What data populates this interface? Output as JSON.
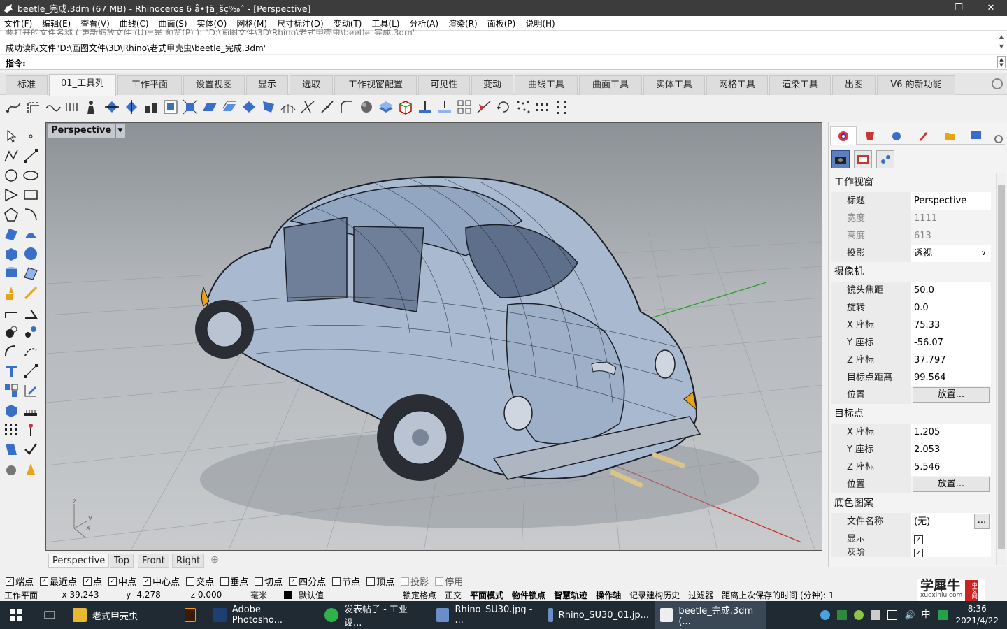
{
  "window": {
    "title": "beetle_完成.3dm (67 MB) - Rhinoceros 6 å•†ä¸šç‰ˆ - [Perspective]"
  },
  "menu": [
    "文件(F)",
    "编辑(E)",
    "查看(V)",
    "曲线(C)",
    "曲面(S)",
    "实体(O)",
    "网格(M)",
    "尺寸标注(D)",
    "变动(T)",
    "工具(L)",
    "分析(A)",
    "渲染(R)",
    "面板(P)",
    "说明(H)"
  ],
  "command_history": {
    "line1": "要打开的文件名称 ( 更新缩放文件 (U)=是 预览(P) ): \"D:\\画图文件\\3D\\Rhino\\老式甲壳虫\\beetle_完成.3dm\"",
    "line2": "成功读取文件\"D:\\画图文件\\3D\\Rhino\\老式甲壳虫\\beetle_完成.3dm\""
  },
  "command_prompt": {
    "label": "指令:",
    "value": ""
  },
  "toolbar_tabs": [
    "标准",
    "01_工具列",
    "工作平面",
    "设置视图",
    "显示",
    "选取",
    "工作视窗配置",
    "可见性",
    "变动",
    "曲线工具",
    "曲面工具",
    "实体工具",
    "网格工具",
    "渲染工具",
    "出图",
    "V6 的新功能"
  ],
  "viewport": {
    "title": "Perspective",
    "axis_labels": {
      "z": "z",
      "y": "y",
      "x": "x"
    }
  },
  "viewport_tabs": [
    "Perspective",
    "Top",
    "Front",
    "Right"
  ],
  "panel": {
    "sections": {
      "viewport": {
        "header": "工作视窗",
        "title_label": "标题",
        "title_value": "Perspective",
        "width_label": "宽度",
        "width_value": "1111",
        "height_label": "高度",
        "height_value": "613",
        "projection_label": "投影",
        "projection_value": "透视"
      },
      "camera": {
        "header": "摄像机",
        "lens_label": "镜头焦距",
        "lens_value": "50.0",
        "rotation_label": "旋转",
        "rotation_value": "0.0",
        "x_label": "X 座标",
        "x_value": "75.33",
        "y_label": "Y 座标",
        "y_value": "-56.07",
        "z_label": "Z 座标",
        "z_value": "37.797",
        "dist_label": "目标点距离",
        "dist_value": "99.564",
        "pos_label": "位置",
        "place_button": "放置..."
      },
      "target": {
        "header": "目标点",
        "x_label": "X 座标",
        "x_value": "1.205",
        "y_label": "Y 座标",
        "y_value": "2.053",
        "z_label": "Z 座标",
        "z_value": "5.546",
        "pos_label": "位置",
        "place_button": "放置..."
      },
      "wallpaper": {
        "header": "底色图案",
        "filename_label": "文件名称",
        "filename_value": "(无)",
        "browse_button": "...",
        "show_label": "显示",
        "gray_label": "灰阶"
      }
    }
  },
  "osnap": [
    {
      "label": "端点",
      "checked": true
    },
    {
      "label": "最近点",
      "checked": true
    },
    {
      "label": "点",
      "checked": true
    },
    {
      "label": "中点",
      "checked": true
    },
    {
      "label": "中心点",
      "checked": true
    },
    {
      "label": "交点",
      "checked": false
    },
    {
      "label": "垂点",
      "checked": false
    },
    {
      "label": "切点",
      "checked": false
    },
    {
      "label": "四分点",
      "checked": true
    },
    {
      "label": "节点",
      "checked": false
    },
    {
      "label": "顶点",
      "checked": false
    },
    {
      "label": "投影",
      "checked": false
    },
    {
      "label": "停用",
      "checked": false
    }
  ],
  "status": {
    "cplane": "工作平面",
    "x": "x 39.243",
    "y": "y -4.278",
    "z": "z 0.000",
    "unit": "毫米",
    "layer": "默认值",
    "grid_snap": "锁定格点",
    "ortho": "正交",
    "planar": "平面模式",
    "osnap_toggle": "物件锁点",
    "smarttrack": "智慧轨迹",
    "gumball": "操作轴",
    "history": "记录建构历史",
    "filter": "过滤器",
    "autosave": "距离上次保存的时间 (分钟): 1"
  },
  "taskbar": {
    "items": [
      "老式甲壳虫",
      "Adobe Photosho...",
      "发表帖子 - 工业设...",
      "Rhino_SU30.jpg - ...",
      "Rhino_SU30_01.jp...",
      "beetle_完成.3dm (..."
    ],
    "time": "8:36",
    "date": "2021/4/22"
  },
  "watermark": {
    "text": "学犀牛",
    "url": "xuexiniu.com",
    "badge": "中文网"
  },
  "colors": {
    "titlebar": "#3c3c3c",
    "viewport_bg": "#b4b8bc",
    "taskbar": "#1f2a33",
    "car_body": "#a9b9cf"
  }
}
